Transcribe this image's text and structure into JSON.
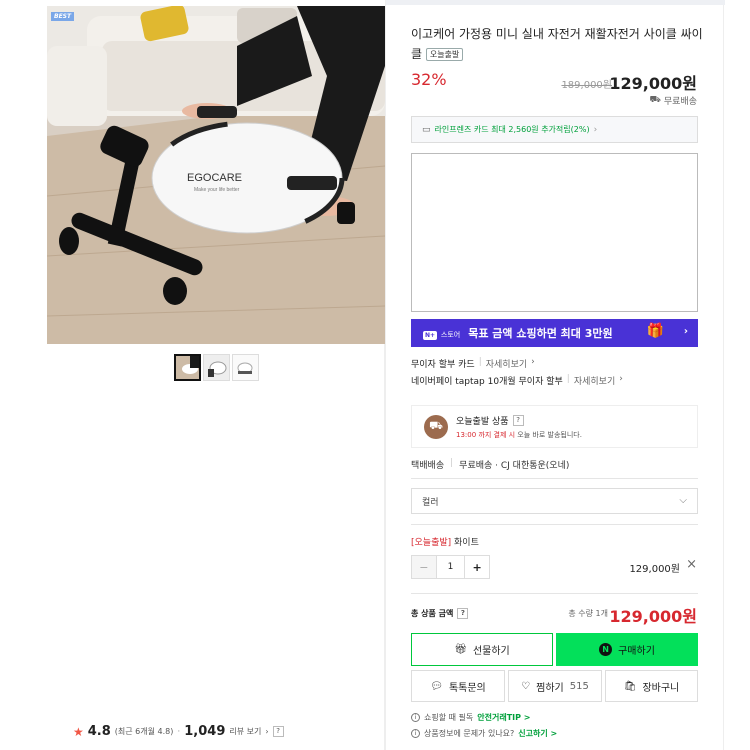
{
  "gallery": {
    "best_badge": "BEST",
    "brand_text": "EGOCARE",
    "brand_sub": "Make your life better"
  },
  "rating": {
    "score": "4.8",
    "recent": "(최근 6개월 4.8)",
    "review_count": "1,049",
    "review_label": "리뷰 보기",
    "help": "?"
  },
  "product": {
    "title": "이고케어 가정용 미니 실내 자전거 재활자전거 사이클 싸이클",
    "today_badge": "오늘출발",
    "discount": "32%",
    "original_price": "189,000원",
    "price": "129,000원",
    "shipping": "무료배송"
  },
  "card_promo": "라인프렌즈 카드 최대 2,560원 추가적립(2%)",
  "banner": {
    "nplus": "N+",
    "store": "스토어",
    "text": "목표 금액 쇼핑하면 최대 3만원"
  },
  "payment_info": [
    {
      "label": "무이자 할부 카드",
      "detail": "자세히보기"
    },
    {
      "label": "네이버페이 taptap 10개월 무이자 할부",
      "detail": "자세히보기"
    }
  ],
  "today_ship": {
    "title": "오늘출발 상품",
    "help": "?",
    "sub_red": "13:00 까지 결제 시",
    "sub_rest": "오늘 바로 발송됩니다."
  },
  "delivery": {
    "type": "택배배송",
    "fee": "무료배송 · CJ 대한통운(오네)"
  },
  "option_select": {
    "placeholder": "컬러"
  },
  "selected_option": {
    "tag": "[오늘출발]",
    "name": "화이트",
    "qty": "1",
    "price": "129,000원"
  },
  "total": {
    "label": "총 상품 금액",
    "help": "?",
    "qty": "총 수량 1개",
    "price": "129,000원"
  },
  "buttons": {
    "gift": "선물하기",
    "buy": "구매하기",
    "talk": "톡톡문의",
    "zzim": "찜하기",
    "zzim_count": "515",
    "cart": "장바구니"
  },
  "notices": [
    {
      "text": "쇼핑할 때 필독",
      "link": "안전거래TIP >"
    },
    {
      "text": "상품정보에 문제가 있나요?",
      "link": "신고하기 >"
    }
  ]
}
